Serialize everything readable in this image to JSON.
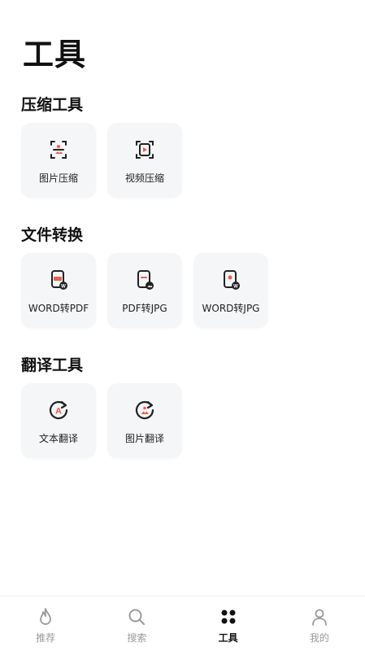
{
  "header": {
    "title": "工具"
  },
  "sections": [
    {
      "title": "压缩工具",
      "items": [
        {
          "label": "图片压缩",
          "icon": "image-compress-icon"
        },
        {
          "label": "视频压缩",
          "icon": "video-compress-icon"
        }
      ]
    },
    {
      "title": "文件转换",
      "items": [
        {
          "label": "WORD转PDF",
          "icon": "word-to-pdf-icon"
        },
        {
          "label": "PDF转JPG",
          "icon": "pdf-to-jpg-icon"
        },
        {
          "label": "WORD转JPG",
          "icon": "word-to-jpg-icon"
        }
      ]
    },
    {
      "title": "翻译工具",
      "items": [
        {
          "label": "文本翻译",
          "icon": "text-translate-icon"
        },
        {
          "label": "图片翻译",
          "icon": "image-translate-icon"
        }
      ]
    }
  ],
  "tabbar": {
    "active": "工具",
    "items": [
      {
        "label": "推荐",
        "icon": "flame-icon"
      },
      {
        "label": "搜索",
        "icon": "search-icon"
      },
      {
        "label": "工具",
        "icon": "four-dots-icon"
      },
      {
        "label": "我的",
        "icon": "person-icon"
      }
    ]
  },
  "colors": {
    "accent": "#e8604c",
    "text": "#111111",
    "muted": "#9a9a9a",
    "card_bg": "#f4f6f8"
  }
}
